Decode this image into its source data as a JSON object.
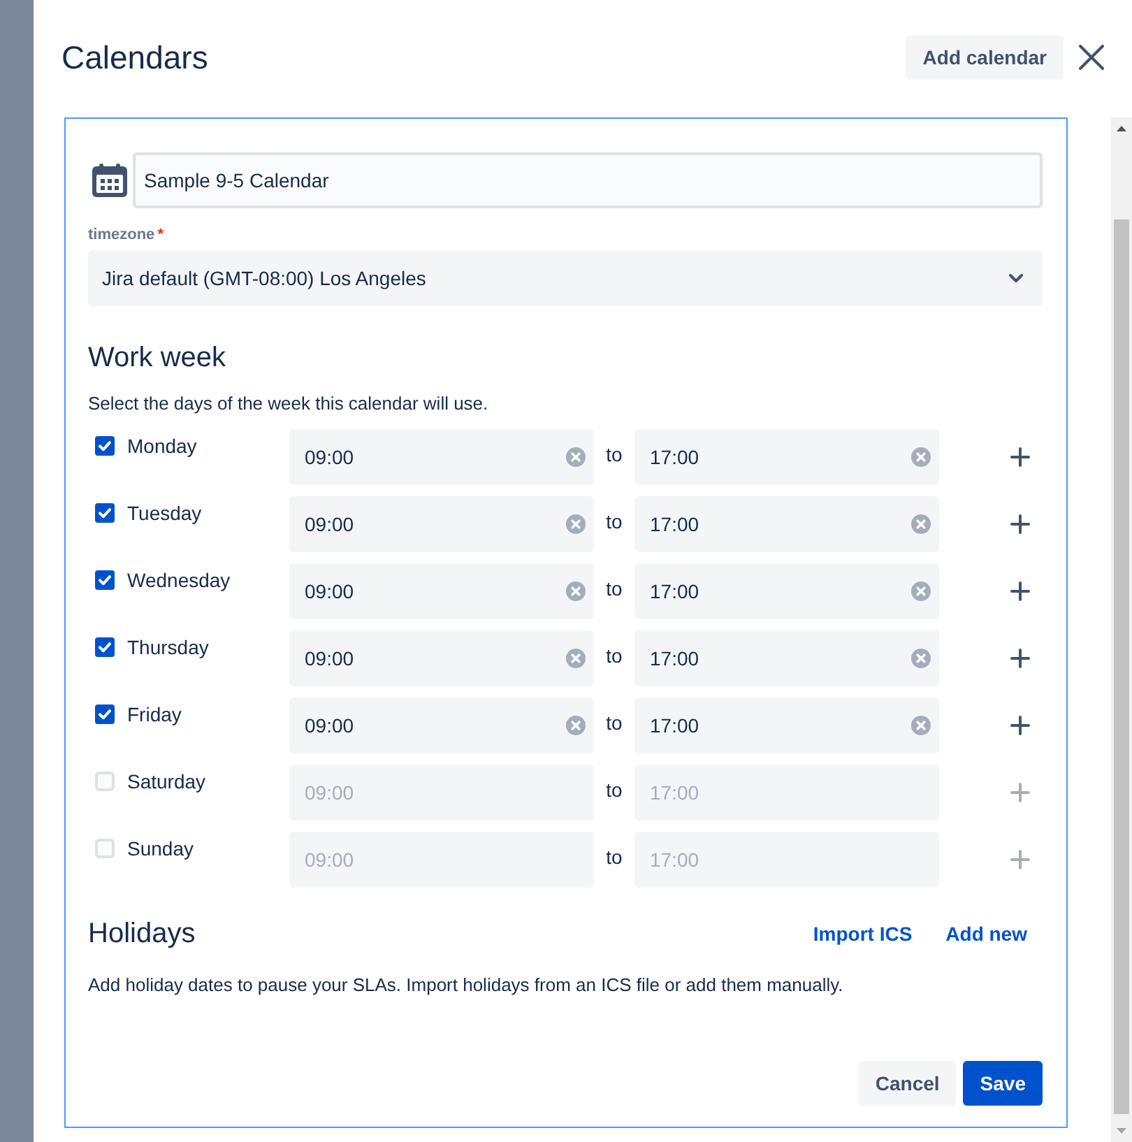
{
  "dialog": {
    "title": "Calendars",
    "add_button": "Add calendar"
  },
  "calendar": {
    "name": "Sample 9-5 Calendar",
    "timezone_label": "timezone",
    "required_mark": "*",
    "timezone": "Jira default (GMT-08:00) Los Angeles"
  },
  "work_week": {
    "heading": "Work week",
    "description": "Select the days of the week this calendar will use.",
    "days": [
      {
        "name": "Monday",
        "checked": true,
        "start": "09:00",
        "separator": "to",
        "end": "17:00"
      },
      {
        "name": "Tuesday",
        "checked": true,
        "start": "09:00",
        "separator": "to",
        "end": "17:00"
      },
      {
        "name": "Wednesday",
        "checked": true,
        "start": "09:00",
        "separator": "to",
        "end": "17:00"
      },
      {
        "name": "Thursday",
        "checked": true,
        "start": "09:00",
        "separator": "to",
        "end": "17:00"
      },
      {
        "name": "Friday",
        "checked": true,
        "start": "09:00",
        "separator": "to",
        "end": "17:00"
      },
      {
        "name": "Saturday",
        "checked": false,
        "start": "09:00",
        "separator": "to",
        "end": "17:00"
      },
      {
        "name": "Sunday",
        "checked": false,
        "start": "09:00",
        "separator": "to",
        "end": "17:00"
      }
    ]
  },
  "holidays": {
    "heading": "Holidays",
    "links": [
      "Import ICS",
      "Add new"
    ],
    "description": "Add holiday dates to pause your SLAs. Import holidays from an ICS file or add them manually."
  },
  "buttons": [
    {
      "label": "Cancel",
      "kind": "subtle"
    },
    {
      "label": "Save",
      "kind": "primary"
    }
  ]
}
